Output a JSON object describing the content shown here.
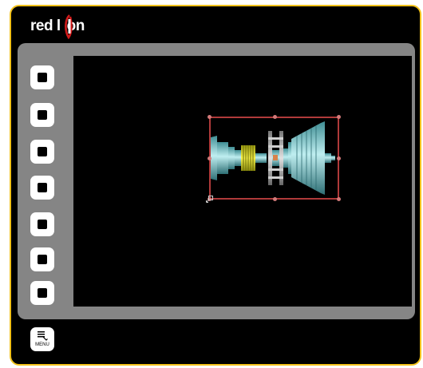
{
  "brand": {
    "logo_text_left": "red l",
    "logo_text_right": "on",
    "accent_color": "#f2c21b",
    "logo_accent_color": "#d11a1a"
  },
  "soft_keys": [
    {
      "name": "soft-key-1"
    },
    {
      "name": "soft-key-2"
    },
    {
      "name": "soft-key-3"
    },
    {
      "name": "soft-key-4"
    },
    {
      "name": "soft-key-5"
    },
    {
      "name": "soft-key-6"
    },
    {
      "name": "soft-key-7"
    }
  ],
  "screen": {
    "background": "#000000",
    "widget": {
      "type": "turbine-image",
      "selected": true,
      "selection_color": "#b03a3a"
    }
  },
  "menu_key": {
    "label": "MENU",
    "icon": "menu-icon"
  }
}
